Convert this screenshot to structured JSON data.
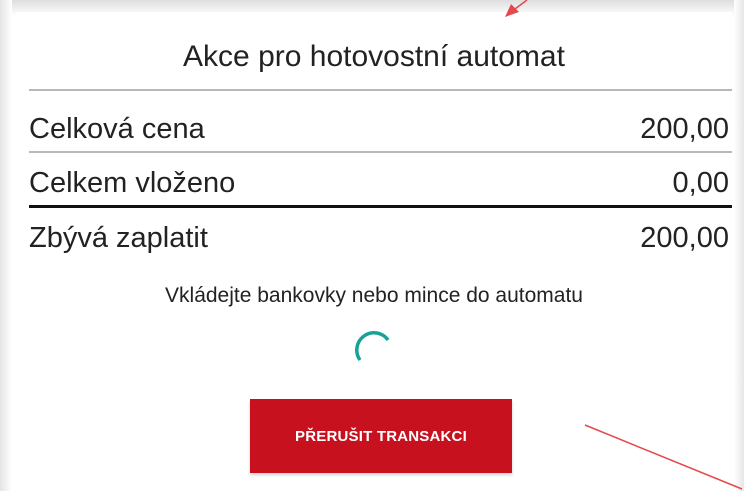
{
  "dialog": {
    "title": "Akce pro hotovostní automat",
    "rows": [
      {
        "label": "Celková cena",
        "value": "200,00"
      },
      {
        "label": "Celkem vloženo",
        "value": "0,00"
      },
      {
        "label": "Zbývá zaplatit",
        "value": "200,00"
      }
    ],
    "message": "Vkládejte bankovky nebo mince do automatu",
    "cancel_label": "PŘERUŠIT TRANSAKCI"
  },
  "colors": {
    "button": "#c8111f",
    "spinner": "#18a195",
    "annotation": "#e5484d"
  },
  "icons": {
    "spinner": "loading-spinner-icon"
  }
}
